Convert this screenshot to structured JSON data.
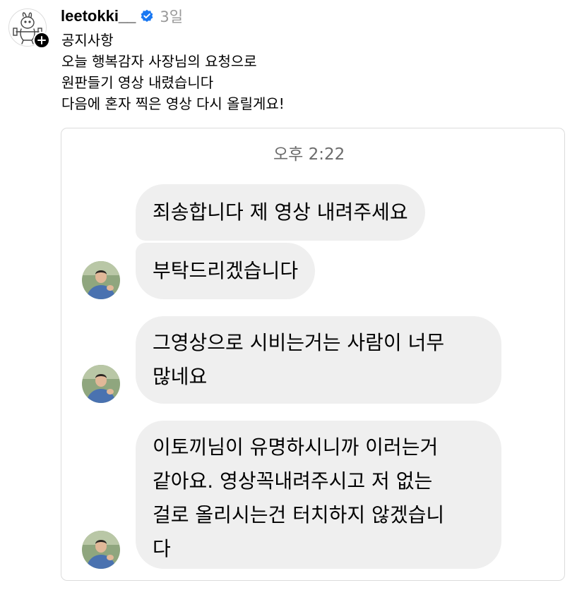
{
  "post": {
    "username": "leetokki__",
    "verified_icon": "verified-badge-icon",
    "time": "3일",
    "caption_lines": [
      "공지사항",
      "오늘 행복감자 사장님의 요청으로",
      "원판들기 영상 내렸습니다",
      "다음에 혼자 찍은 영상 다시 올릴게요!"
    ]
  },
  "chat": {
    "time": "오후 2:22",
    "messages": [
      {
        "lines": [
          "죄송합니다 제 영상 내려주세요"
        ]
      },
      {
        "lines": [
          "부탁드리겠습니다"
        ]
      },
      {
        "lines": [
          "그영상으로 시비는거는 사람이 너무",
          "많네요"
        ]
      },
      {
        "lines": [
          "이토끼님이 유명하시니까 이러는거",
          "같아요. 영상꼭내려주시고 저 없는",
          "걸로 올리시는건 터치하지 않겠습니",
          "다"
        ]
      }
    ]
  },
  "colors": {
    "verified": "#1877F2",
    "bubble": "#EFEFEF",
    "muted_text": "#999999",
    "card_border": "#DCDCDC"
  }
}
